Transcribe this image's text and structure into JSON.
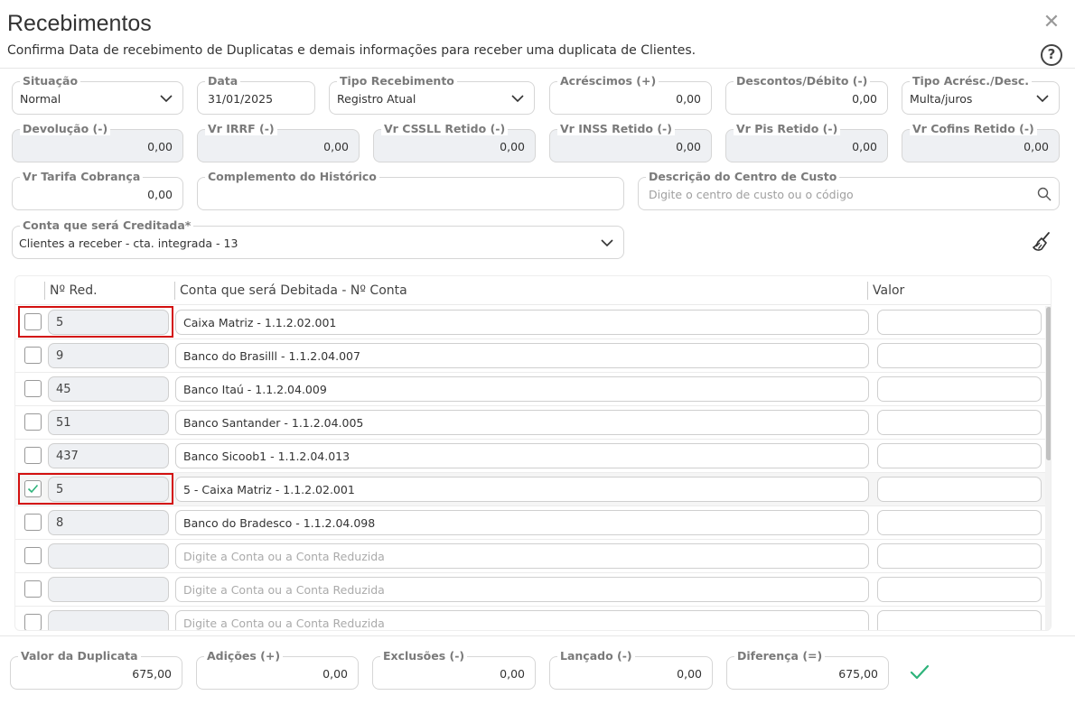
{
  "header": {
    "title": "Recebimentos",
    "subtitle": "Confirma Data de recebimento de Duplicatas e demais informações para receber uma duplicata de Clientes.",
    "help_label": "?"
  },
  "form": {
    "situacao": {
      "label": "Situação",
      "value": "Normal"
    },
    "data": {
      "label": "Data",
      "value": "31/01/2025"
    },
    "tipo_recebimento": {
      "label": "Tipo Recebimento",
      "value": "Registro Atual"
    },
    "acrescimos": {
      "label": "Acréscimos (+)",
      "value": "0,00"
    },
    "descontos": {
      "label": "Descontos/Débito (-)",
      "value": "0,00"
    },
    "tipo_acresc": {
      "label": "Tipo Acrésc./Desc.",
      "value": "Multa/juros"
    },
    "devolucao": {
      "label": "Devolução (-)",
      "value": "0,00"
    },
    "vr_irrf": {
      "label": "Vr IRRF (-)",
      "value": "0,00"
    },
    "vr_csll": {
      "label": "Vr CSSLL Retido (-)",
      "value": "0,00"
    },
    "vr_inss": {
      "label": "Vr INSS Retido (-)",
      "value": "0,00"
    },
    "vr_pis": {
      "label": "Vr Pis Retido (-)",
      "value": "0,00"
    },
    "vr_cofins": {
      "label": "Vr Cofins Retido (-)",
      "value": "0,00"
    },
    "vr_tarifa": {
      "label": "Vr Tarifa Cobrança",
      "value": "0,00"
    },
    "complemento": {
      "label": "Complemento do Histórico",
      "value": ""
    },
    "centro_custo": {
      "label": "Descrição do Centro de Custo",
      "placeholder": "Digite o centro de custo ou o código"
    },
    "conta_creditada": {
      "label": "Conta que será Creditada*",
      "value": "Clientes a receber - cta. integrada - 13"
    }
  },
  "table": {
    "headers": {
      "red": "Nº Red.",
      "conta": "Conta que será Debitada - Nº Conta",
      "valor": "Valor"
    },
    "placeholder": "Digite a Conta ou a Conta Reduzida",
    "rows": [
      {
        "red": "5",
        "conta": "Caixa Matriz  - 1.1.2.02.001",
        "checked": false
      },
      {
        "red": "9",
        "conta": "Banco do Brasilll - 1.1.2.04.007",
        "checked": false
      },
      {
        "red": "45",
        "conta": "Banco Itaú - 1.1.2.04.009",
        "checked": false
      },
      {
        "red": "51",
        "conta": "Banco Santander - 1.1.2.04.005",
        "checked": false
      },
      {
        "red": "437",
        "conta": "Banco Sicoob1 - 1.1.2.04.013",
        "checked": false
      },
      {
        "red": "5",
        "conta": "5 - Caixa Matriz - 1.1.2.02.001",
        "checked": true
      },
      {
        "red": "8",
        "conta": "Banco do Bradesco - 1.1.2.04.098",
        "checked": false
      },
      {
        "red": "",
        "conta": "",
        "checked": false
      },
      {
        "red": "",
        "conta": "",
        "checked": false
      },
      {
        "red": "",
        "conta": "",
        "checked": false
      }
    ]
  },
  "totals": {
    "valor_duplicata": {
      "label": "Valor da Duplicata",
      "value": "675,00"
    },
    "adicoes": {
      "label": "Adições (+)",
      "value": "0,00"
    },
    "exclusoes": {
      "label": "Exclusões (-)",
      "value": "0,00"
    },
    "lancado": {
      "label": "Lançado (-)",
      "value": "0,00"
    },
    "diferenca": {
      "label": "Diferença (=)",
      "value": "675,00"
    }
  },
  "colors": {
    "highlight_red": "#d3100f",
    "check_green": "#2db37a"
  }
}
